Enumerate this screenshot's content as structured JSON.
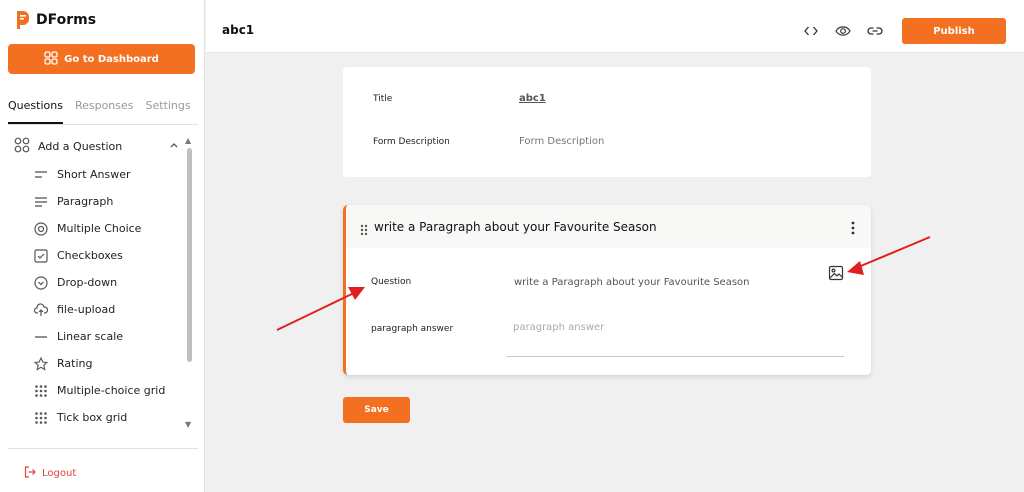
{
  "app": {
    "name": "DForms"
  },
  "sidebar": {
    "dashboard_label": "Go to Dashboard",
    "tabs": [
      {
        "label": "Questions",
        "active": true
      },
      {
        "label": "Responses",
        "active": false
      },
      {
        "label": "Settings",
        "active": false
      }
    ],
    "add_question_label": "Add a Question",
    "question_types": [
      {
        "label": "Short Answer",
        "icon": "short-answer-icon"
      },
      {
        "label": "Paragraph",
        "icon": "paragraph-icon"
      },
      {
        "label": "Multiple Choice",
        "icon": "radio-icon"
      },
      {
        "label": "Checkboxes",
        "icon": "checkbox-icon"
      },
      {
        "label": "Drop-down",
        "icon": "dropdown-icon"
      },
      {
        "label": "file-upload",
        "icon": "upload-icon"
      },
      {
        "label": "Linear scale",
        "icon": "linear-scale-icon"
      },
      {
        "label": "Rating",
        "icon": "star-icon"
      },
      {
        "label": "Multiple-choice grid",
        "icon": "grid-icon"
      },
      {
        "label": "Tick box grid",
        "icon": "grid-icon"
      }
    ],
    "logout_label": "Logout"
  },
  "header": {
    "form_name": "abc1",
    "publish_label": "Publish"
  },
  "form_info": {
    "title_label": "Title",
    "title_value": "abc1",
    "description_label": "Form Description",
    "description_placeholder": "Form Description"
  },
  "question_card": {
    "title": "write a Paragraph about your Favourite Season",
    "question_label": "Question",
    "question_value": "write a Paragraph about your Favourite Season",
    "answer_label": "paragraph answer",
    "answer_placeholder": "paragraph answer"
  },
  "save_label": "Save",
  "colors": {
    "accent": "#f37021",
    "annotation_arrow": "#e02020",
    "logout": "#e0433a"
  }
}
